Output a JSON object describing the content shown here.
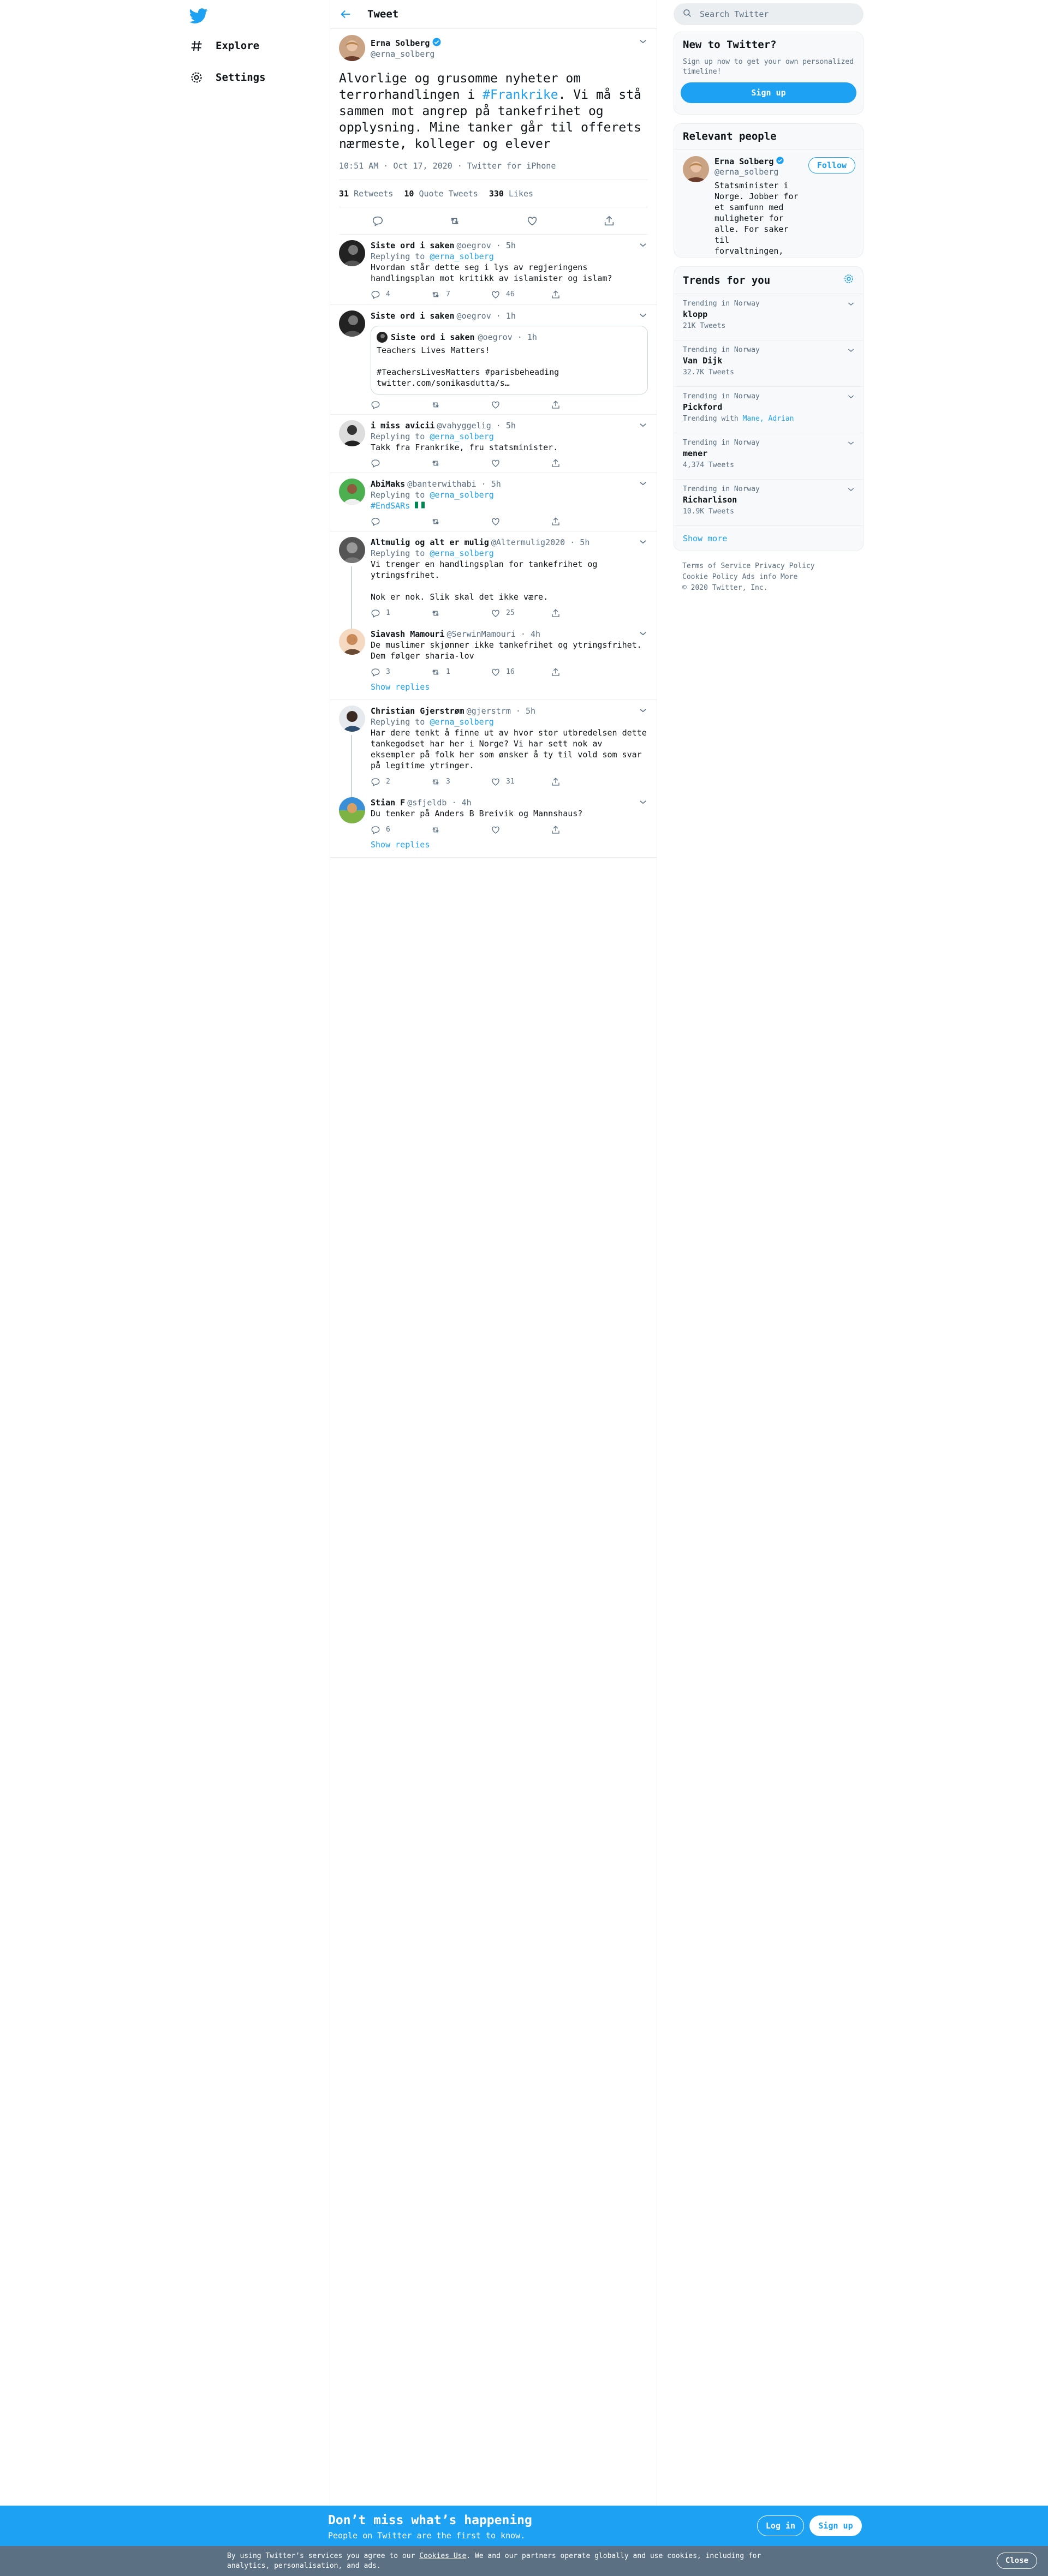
{
  "nav": {
    "logo": "twitter-bird-icon",
    "items": [
      {
        "label": "Explore",
        "icon": "hashtag-icon"
      },
      {
        "label": "Settings",
        "icon": "gear-icon"
      }
    ]
  },
  "header": {
    "title": "Tweet"
  },
  "focus_tweet": {
    "name": "Erna Solberg",
    "handle": "@erna_solberg",
    "text_before": "Alvorlige og grusomme nyheter om terrorhandlingen i ",
    "hashtag": "#Frankrike",
    "text_after": ". Vi må stå sammen mot angrep på tankefrihet og opplysning. Mine tanker går til offerets nærmeste, kolleger og elever",
    "meta": "10:51 AM · Oct 17, 2020 · Twitter for iPhone",
    "retweets": "31",
    "retweets_label": "Retweets",
    "quotes": "10",
    "quotes_label": "Quote Tweets",
    "likes": "330",
    "likes_label": "Likes"
  },
  "replies": [
    {
      "name": "Siste ord i saken",
      "handle": "@oegrov · 5h",
      "replying": "Replying to ",
      "replying_to": "@erna_solberg",
      "text": "Hvordan står dette seg i lys av regjeringens handlingsplan mot kritikk av islamister og islam?",
      "replies": "4",
      "retweets": "7",
      "likes": "46"
    },
    {
      "name": "Siste ord i saken",
      "handle": "@oegrov · 1h",
      "quote_name": "Siste ord i saken",
      "quote_handle": "@oegrov · 1h",
      "quote_text": "Teachers Lives Matters!\n\n#TeachersLivesMatters #parisbeheading twitter.com/sonikasdutta/s…"
    },
    {
      "name": "i miss avicii",
      "handle": "@vahyggelig · 5h",
      "replying": "Replying to ",
      "replying_to": "@erna_solberg",
      "text": "Takk fra Frankrike, fru statsminister."
    },
    {
      "name": "AbiMaks",
      "handle": "@banterwithabi · 5h",
      "replying": "Replying to ",
      "replying_to": "@erna_solberg",
      "text": "#EndSARs"
    },
    {
      "name": "Altmulig og alt er mulig",
      "handle": "@Altermulig2020 · 5h",
      "replying": "Replying to ",
      "replying_to": "@erna_solberg",
      "text": "Vi trenger en handlingsplan for tankefrihet og ytringsfrihet.\n\nNok er nok. Slik skal det ikke være.",
      "replies": "1",
      "likes": "25"
    },
    {
      "name": "Siavash Mamouri",
      "handle": "@SerwinMamouri · 4h",
      "text": "De muslimer skjønner ikke tankefrihet og ytringsfrihet. Dem følger sharia-lov",
      "replies": "3",
      "retweets": "1",
      "likes": "16"
    },
    {
      "name": "Christian Gjerstrøm",
      "handle": "@gjerstrm · 5h",
      "replying": "Replying to ",
      "replying_to": "@erna_solberg",
      "text": "Har dere tenkt å finne ut av hvor stor utbredelsen dette tankegodset har her i Norge? Vi har sett nok av eksempler på folk her som ønsker å ty til vold som svar på legitime ytringer.",
      "replies": "2",
      "retweets": "3",
      "likes": "31"
    },
    {
      "name": "Stian F",
      "handle": "@sfjeldb · 4h",
      "text": "Du tenker på Anders B Breivik og Mannshaus?",
      "replies": "6"
    }
  ],
  "show_replies": "Show replies",
  "sidebar": {
    "search_placeholder": "Search Twitter",
    "new_title": "New to Twitter?",
    "new_text": "Sign up now to get your own personalized timeline!",
    "signup": "Sign up",
    "relevant_title": "Relevant people",
    "person_name": "Erna Solberg",
    "person_handle": "@erna_solberg",
    "follow": "Follow",
    "person_bio": "Statsminister i Norge. Jobber for et samfunn med muligheter for alle. For saker til forvaltningen, henvend deg til rette myndighet for saksbehandling.",
    "trends_title": "Trends for you",
    "trends": [
      {
        "ctx": "Trending in Norway",
        "name": "klopp",
        "count": "21K Tweets"
      },
      {
        "ctx": "Trending in Norway",
        "name": "Van Dijk",
        "count": "32.7K Tweets"
      },
      {
        "ctx": "Trending in Norway",
        "name": "Pickford",
        "count_prefix": "Trending with ",
        "count_link": "Mane, Adrian"
      },
      {
        "ctx": "Trending in Norway",
        "name": "mener",
        "count": "4,374 Tweets"
      },
      {
        "ctx": "Trending in Norway",
        "name": "Richarlison",
        "count": "10.9K Tweets"
      }
    ],
    "show_more": "Show more",
    "footer1": "Terms of Service  Privacy Policy",
    "footer2": "Cookie Policy  Ads info  More",
    "footer3": "© 2020 Twitter, Inc."
  },
  "bottom_bar": {
    "title": "Don’t miss what’s happening",
    "subtitle": "People on Twitter are the first to know.",
    "login": "Log in",
    "signup": "Sign up"
  },
  "cookie": {
    "before": "By using Twitter’s services you agree to our ",
    "link": "Cookies Use",
    "after": ". We and our partners operate globally and use cookies, including for analytics, personalisation, and ads.",
    "close": "Close"
  },
  "colors": {
    "accent": "#1da1f2",
    "text": "#0f1419",
    "muted": "#5b7083"
  }
}
